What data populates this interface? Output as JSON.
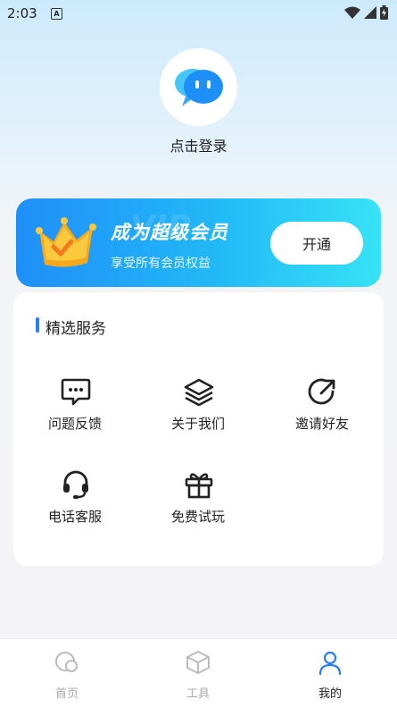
{
  "status": {
    "time": "2:03",
    "a_icon": "A"
  },
  "profile": {
    "login_text": "点击登录"
  },
  "vip": {
    "title": "成为超级会员",
    "watermark": "VIP",
    "subtitle": "享受所有会员权益",
    "button": "开通"
  },
  "services": {
    "title": "精选服务",
    "items": [
      {
        "label": "问题反馈",
        "icon": "message-icon"
      },
      {
        "label": "关于我们",
        "icon": "layers-icon"
      },
      {
        "label": "邀请好友",
        "icon": "share-icon"
      },
      {
        "label": "电话客服",
        "icon": "headset-icon"
      },
      {
        "label": "免费试玩",
        "icon": "gift-icon"
      }
    ]
  },
  "nav": {
    "items": [
      {
        "label": "首页",
        "icon": "home-icon",
        "active": false
      },
      {
        "label": "工具",
        "icon": "box-icon",
        "active": false
      },
      {
        "label": "我的",
        "icon": "user-icon",
        "active": true
      }
    ]
  },
  "colors": {
    "accent": "#2a7cf7",
    "vip_start": "#1f8ff8",
    "vip_end": "#37e3f6"
  }
}
